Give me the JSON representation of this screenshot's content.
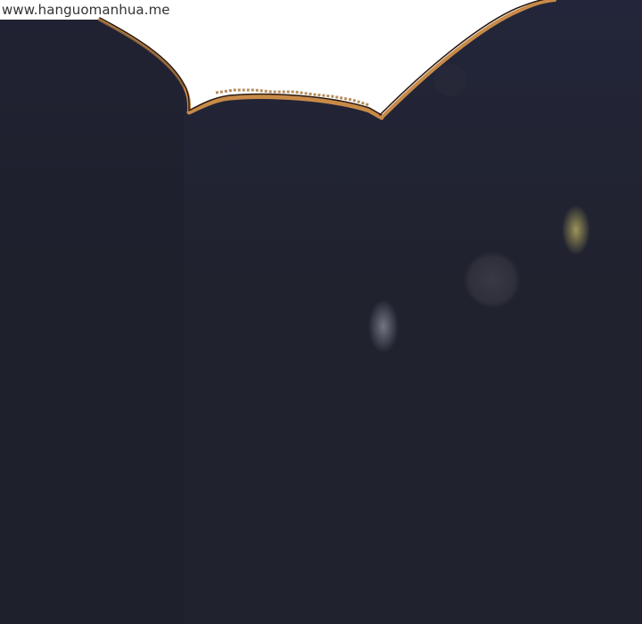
{
  "watermark": {
    "text": "www.hanguomanhua.me"
  },
  "colors": {
    "sky": "#ffffff",
    "night_fill": "#20222e",
    "night_fill_top": "#23263a",
    "outline_dark": "#2a1a10",
    "outline_orange": "#c88a48",
    "bokeh_yellow": "#8a8450",
    "bokeh_gray": "#6b6d7a",
    "bokeh_ring": "#3a3b44"
  }
}
